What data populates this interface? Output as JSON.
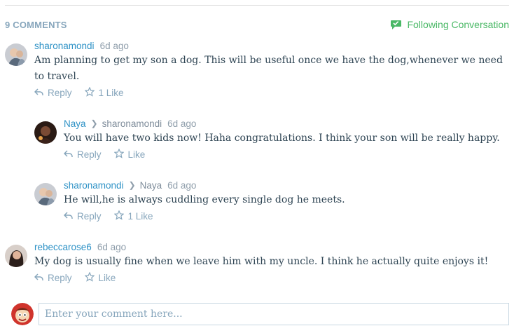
{
  "header": {
    "count_label": "9 COMMENTS",
    "follow_label": "Following Conversation"
  },
  "colors": {
    "accent_blue": "#2e92c6",
    "follow_green": "#4ab866",
    "muted": "#87a6bc",
    "text": "#2e4453"
  },
  "comments": [
    {
      "author": "sharonamondi",
      "parent": "",
      "date": "6d ago",
      "text_line1": "Am planning to get my son a dog. This will be useful once we have the dog,whenever we need",
      "text_line2": "to travel.",
      "reply_label": "Reply",
      "like_label": "1 Like"
    },
    {
      "author": "Naya",
      "parent": "sharonamondi",
      "date": "6d ago",
      "text_line1": "You will have two kids now! Haha congratulations. I think your son will be really happy.",
      "reply_label": "Reply",
      "like_label": "Like"
    },
    {
      "author": "sharonamondi",
      "parent": "Naya",
      "date": "6d ago",
      "text_line1": "He will,he is always cuddling every single dog he meets.",
      "reply_label": "Reply",
      "like_label": "1 Like"
    },
    {
      "author": "rebeccarose6",
      "parent": "",
      "date": "6d ago",
      "text_line1": "My dog is usually fine when we leave him with my uncle. I think he actually quite enjoys it!",
      "reply_label": "Reply",
      "like_label": "Like"
    }
  ],
  "composer": {
    "placeholder": "Enter your comment here..."
  },
  "icons": {
    "follow": "speech-bubble-icon",
    "reply": "reply-arrow-icon",
    "like": "star-icon",
    "thread": "chevron-right-icon"
  }
}
